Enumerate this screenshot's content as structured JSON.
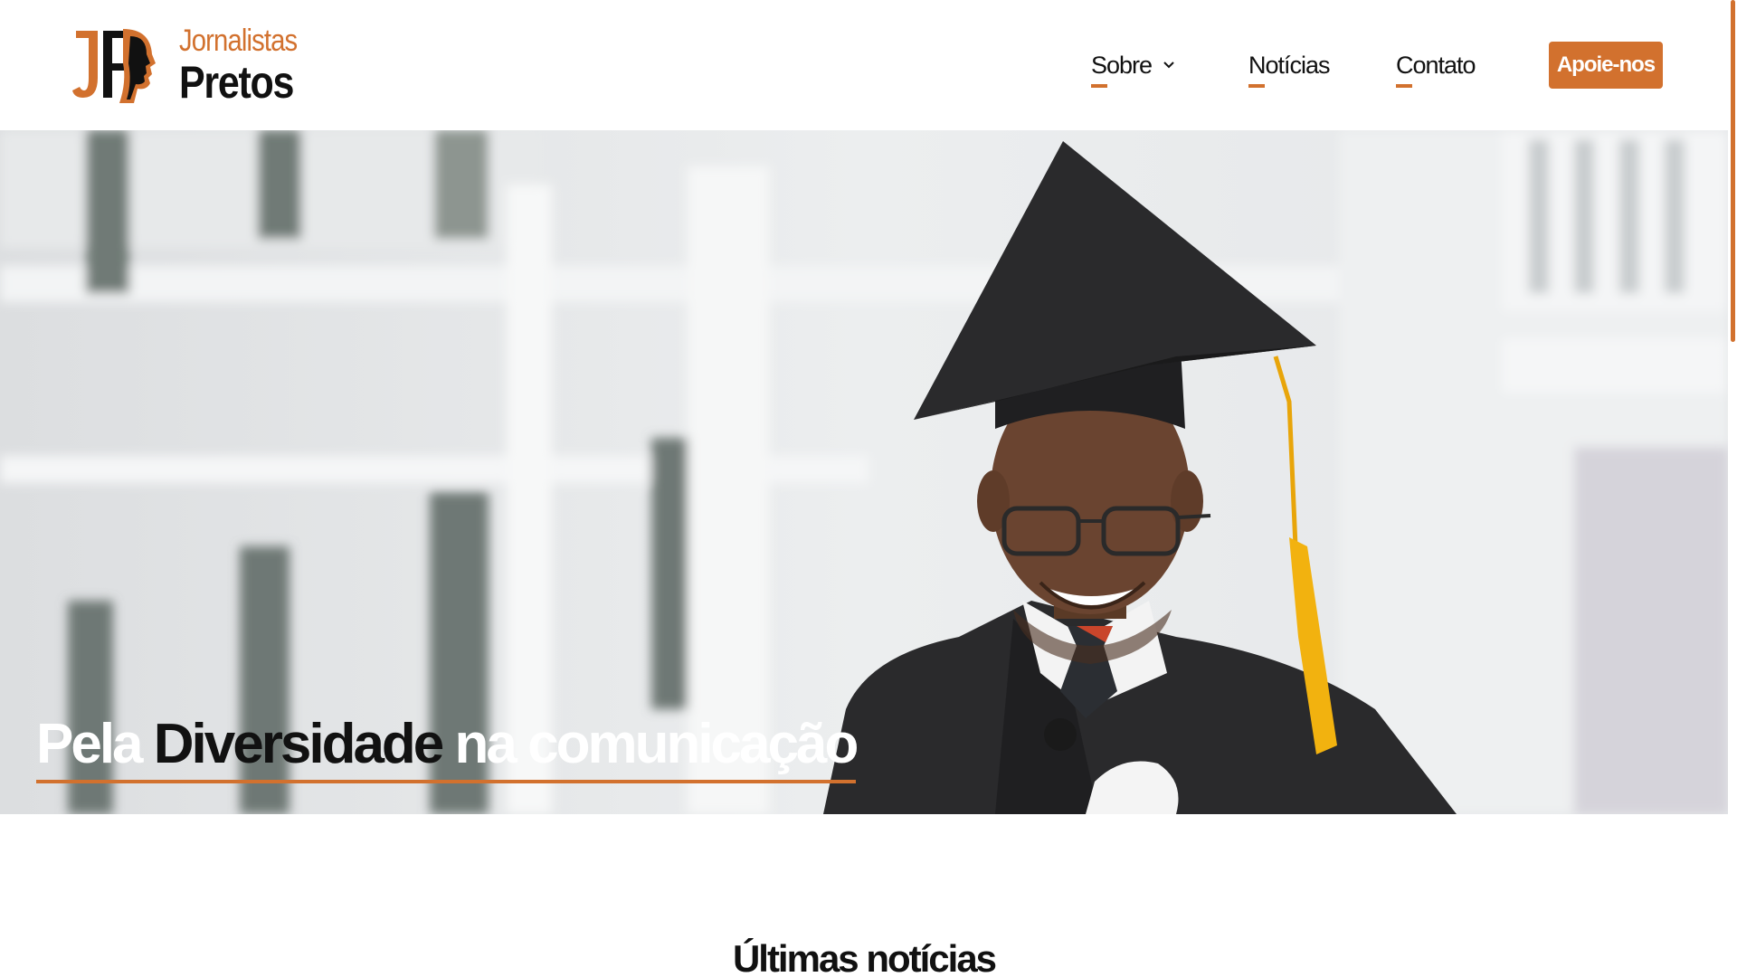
{
  "logo": {
    "line1": "Jornalistas",
    "line2": "Pretos",
    "monogram": "JP"
  },
  "nav": {
    "items": [
      {
        "label": "Sobre",
        "has_dropdown": true
      },
      {
        "label": "Notícias"
      },
      {
        "label": "Contato"
      }
    ],
    "cta_label": "Apoie-nos"
  },
  "hero": {
    "title_part1": "Pela",
    "title_part2": "Diversidade",
    "title_part3": "na comunicação"
  },
  "section": {
    "title": "Últimas notícias"
  },
  "colors": {
    "accent": "#d2712e",
    "text": "#111111",
    "background": "#ffffff"
  }
}
